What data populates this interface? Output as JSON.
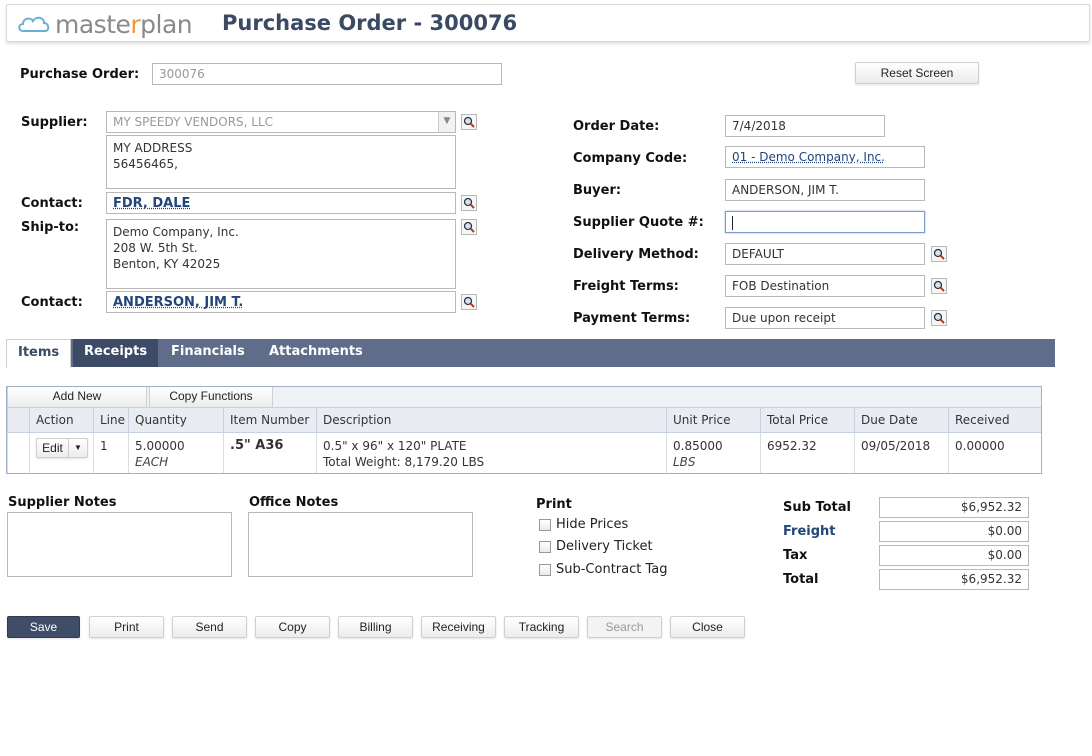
{
  "header": {
    "logo_prefix": "maste",
    "logo_accent": "r",
    "logo_suffix": "plan",
    "title": "Purchase Order - 300076"
  },
  "form": {
    "po_label": "Purchase Order:",
    "po_value": "300076",
    "reset_label": "Reset Screen",
    "supplier_label": "Supplier:",
    "supplier_value": "MY SPEEDY VENDORS, LLC",
    "supplier_address": "MY ADDRESS\n56456465,",
    "contact_label": "Contact:",
    "contact_value": "FDR, DALE",
    "shipto_label": "Ship-to:",
    "shipto_address": "Demo Company, Inc.\n208 W. 5th St.\nBenton, KY  42025",
    "contact2_label": "Contact:",
    "contact2_value": "ANDERSON, JIM T.",
    "order_date_label": "Order Date:",
    "order_date_value": "7/4/2018",
    "company_code_label": "Company Code:",
    "company_code_value": "01 - Demo Company, Inc.",
    "buyer_label": "Buyer:",
    "buyer_value": "ANDERSON, JIM T.",
    "quote_label": "Supplier Quote #:",
    "quote_value": "",
    "delivery_label": "Delivery Method:",
    "delivery_value": "DEFAULT",
    "freight_terms_label": "Freight Terms:",
    "freight_terms_value": "FOB Destination",
    "payment_terms_label": "Payment Terms:",
    "payment_terms_value": "Due upon receipt"
  },
  "tabs": [
    {
      "label": "Items"
    },
    {
      "label": "Receipts"
    },
    {
      "label": "Financials"
    },
    {
      "label": "Attachments"
    }
  ],
  "grid": {
    "toolbar": [
      "Add New",
      "Copy Functions"
    ],
    "columns": [
      "Action",
      "Line",
      "Quantity",
      "Item Number",
      "Description",
      "Unit Price",
      "Total Price",
      "Due Date",
      "Received"
    ],
    "rows": [
      {
        "action": "Edit",
        "line": "1",
        "quantity": "5.00000",
        "uom": "EACH",
        "item_number": ".5\" A36",
        "description": "0.5\" x 96\" x 120\" PLATE",
        "weight": "Total Weight: 8,179.20 LBS",
        "unit_price": "0.85000",
        "price_uom": "LBS",
        "total_price": "6952.32",
        "due_date": "09/05/2018",
        "received": "0.00000"
      }
    ]
  },
  "notes": {
    "supplier_label": "Supplier Notes",
    "office_label": "Office Notes"
  },
  "print": {
    "label": "Print",
    "options": [
      "Hide Prices",
      "Delivery Ticket",
      "Sub-Contract Tag"
    ]
  },
  "totals": {
    "subtotal_label": "Sub Total",
    "subtotal_value": "$6,952.32",
    "freight_label": "Freight",
    "freight_value": "$0.00",
    "tax_label": "Tax",
    "tax_value": "$0.00",
    "total_label": "Total",
    "total_value": "$6,952.32"
  },
  "actions": [
    "Save",
    "Print",
    "Send",
    "Copy",
    "Billing",
    "Receiving",
    "Tracking",
    "Search",
    "Close"
  ],
  "colors": {
    "accent": "#3f4d69",
    "tabbar": "#5f6d8a",
    "link": "#22457a",
    "logo_orange": "#f29a2e"
  }
}
